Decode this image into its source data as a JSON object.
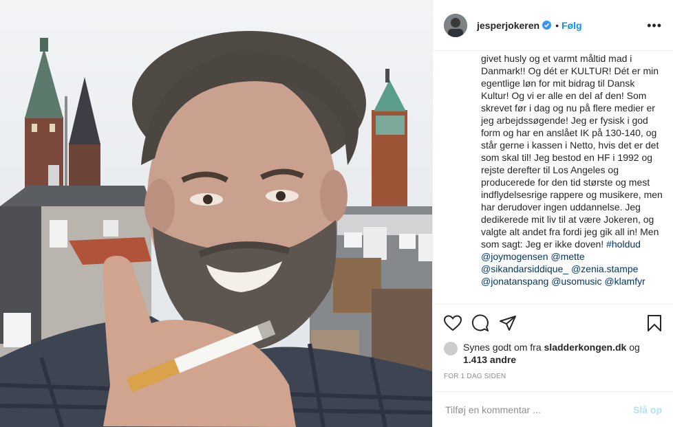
{
  "header": {
    "username": "jesperjokeren",
    "separator": "•",
    "follow_label": "Følg",
    "more_glyph": "•••"
  },
  "caption": {
    "text": "givet husly og et varmt måltid mad i Danmark!! Og dét er KULTUR! Dét er min egentlige løn for mit bidrag til Dansk Kultur! Og vi er alle en del af den! Som skrevet før i dag og nu på flere medier er jeg arbejdssøgende! Jeg er fysisk i god form og har en anslået IK på 130-140, og står gerne i kassen i Netto, hvis det er det som skal til! Jeg bestod en HF i 1992 og rejste derefter til Los Angeles og producerede for den tid største og mest indflydelsesrige rappere og musikere, men har derudover ingen uddannelse. Jeg dedikerede mit liv til at være Jokeren, og valgte alt andet fra fordi jeg gik all in! Men som sagt: Jeg er ikke doven!",
    "hashtag": "#holdud",
    "mentions": [
      "@joymogensen",
      "@mette",
      "@sikandarsiddique_",
      "@zenia.stampe",
      "@jonatanspang",
      "@usomusic",
      "@klamfyr"
    ]
  },
  "likes": {
    "prefix": "Synes godt om fra",
    "user": "sladderkongen.dk",
    "joiner": "og",
    "count": "1.413 andre"
  },
  "timestamp": "FOR 1 DAG SIDEN",
  "comment": {
    "placeholder": "Tilføj en kommentar ...",
    "post_label": "Slå op"
  },
  "colors": {
    "link": "#0095f6",
    "mention": "#00376b",
    "post_disabled": "#b2dffc",
    "verified": "#3897f0"
  },
  "icons": [
    "heart-icon",
    "comment-icon",
    "share-icon",
    "bookmark-icon",
    "verified-badge-icon",
    "more-options-icon"
  ]
}
